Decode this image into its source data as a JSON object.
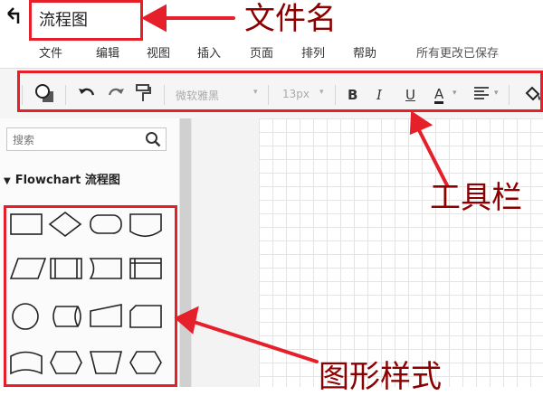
{
  "header": {
    "back_icon": "return-arrow-icon",
    "file_title": "流程图",
    "menu": [
      "文件",
      "编辑",
      "视图",
      "插入",
      "页面",
      "排列",
      "帮助"
    ],
    "save_status": "所有更改已保存"
  },
  "toolbar": {
    "font_family": "微软雅黑",
    "font_size": "13px",
    "bold_label": "B",
    "italic_label": "I",
    "underline_label": "U",
    "font_color_label": "A"
  },
  "sidebar": {
    "search_placeholder": "搜索",
    "category_label": "Flowchart 流程图"
  },
  "annotations": {
    "file_name": "文件名",
    "toolbar": "工具栏",
    "shape_styles": "图形样式"
  },
  "colors": {
    "annotation_red": "#e5202a",
    "annotation_text": "#8b0000"
  }
}
